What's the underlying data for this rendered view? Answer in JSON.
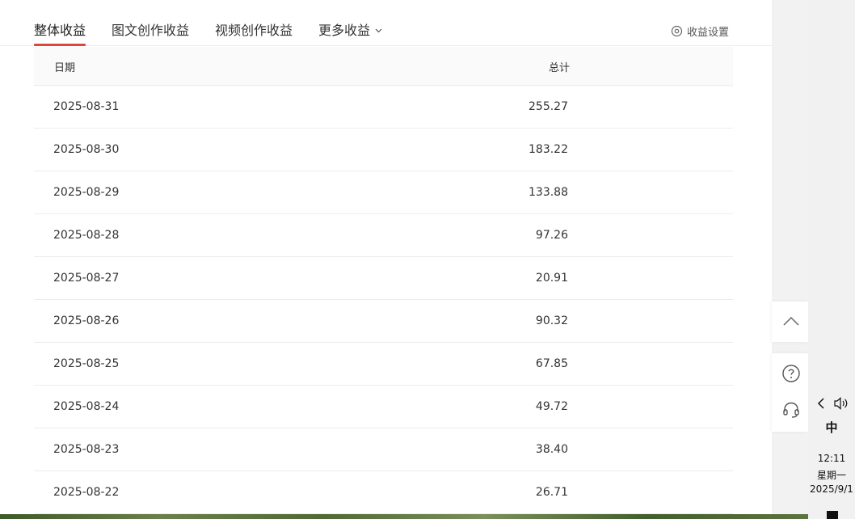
{
  "tabs": [
    {
      "label": "整体收益",
      "active": true
    },
    {
      "label": "图文创作收益",
      "active": false
    },
    {
      "label": "视频创作收益",
      "active": false
    },
    {
      "label": "更多收益",
      "active": false,
      "has_dropdown": true
    }
  ],
  "settings_label": "收益设置",
  "table": {
    "headers": {
      "date": "日期",
      "total": "总计"
    },
    "rows": [
      {
        "date": "2025-08-31",
        "total": "255.27"
      },
      {
        "date": "2025-08-30",
        "total": "183.22"
      },
      {
        "date": "2025-08-29",
        "total": "133.88"
      },
      {
        "date": "2025-08-28",
        "total": "97.26"
      },
      {
        "date": "2025-08-27",
        "total": "20.91"
      },
      {
        "date": "2025-08-26",
        "total": "90.32"
      },
      {
        "date": "2025-08-25",
        "total": "67.85"
      },
      {
        "date": "2025-08-24",
        "total": "49.72"
      },
      {
        "date": "2025-08-23",
        "total": "38.40"
      },
      {
        "date": "2025-08-22",
        "total": "26.71"
      }
    ]
  },
  "floating_buttons": {
    "back_to_top_icon": "chevron-up-icon",
    "help_icon": "question-circle-icon",
    "support_icon": "headset-icon"
  },
  "taskbar": {
    "ime": "中",
    "time": "12:11",
    "weekday": "星期一",
    "date": "2025/9/1"
  },
  "colors": {
    "active_tab_underline": "#e0453a",
    "border": "#ececec"
  }
}
